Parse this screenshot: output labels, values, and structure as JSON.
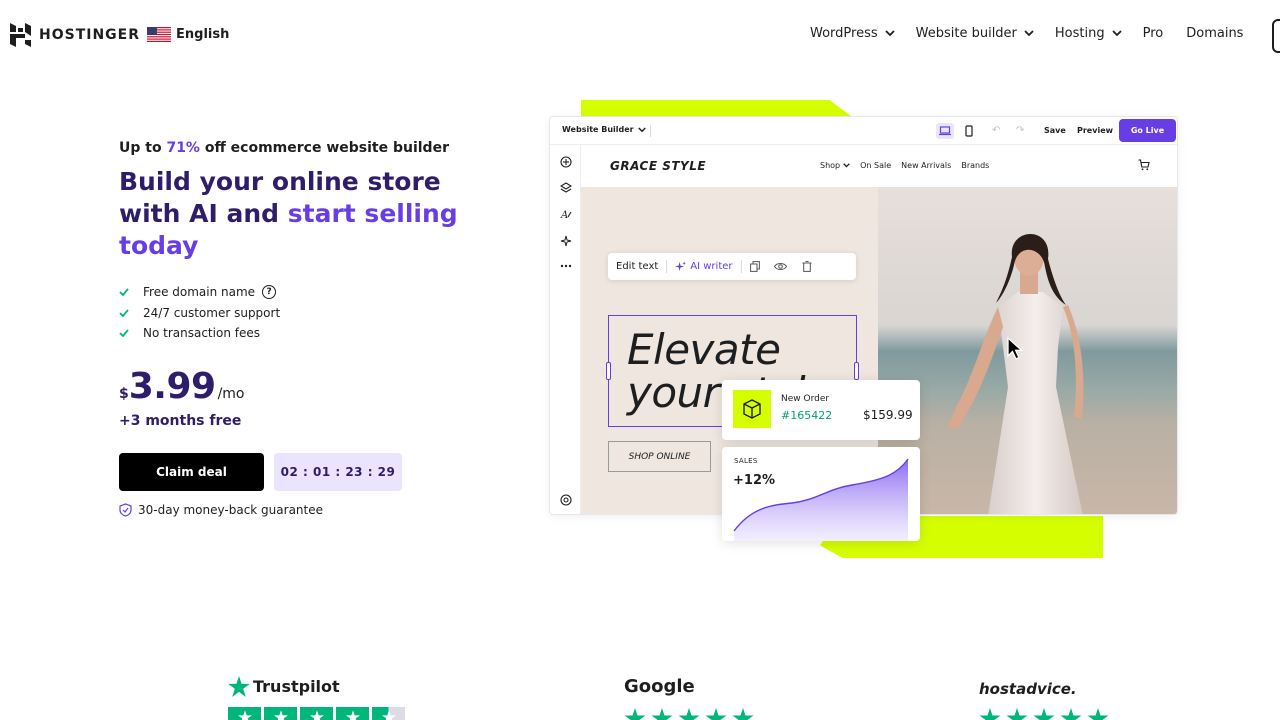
{
  "header": {
    "logo_text": "HOSTINGER",
    "language": "English",
    "nav": [
      {
        "label": "WordPress",
        "dropdown": true
      },
      {
        "label": "Website builder",
        "dropdown": true
      },
      {
        "label": "Hosting",
        "dropdown": true
      },
      {
        "label": "Pro",
        "dropdown": false
      },
      {
        "label": "Domains",
        "dropdown": false
      }
    ]
  },
  "hero": {
    "eyebrow_prefix": "Up to ",
    "eyebrow_discount": "71%",
    "eyebrow_suffix": " off ecommerce website builder",
    "headline_line1": "Build your online store",
    "headline_line2_plain": "with AI and ",
    "headline_line2_accent": "start selling",
    "headline_line3_accent": "today",
    "features": [
      "Free domain name",
      "24/7 customer support",
      "No transaction fees"
    ],
    "price_currency": "$",
    "price_value": "3.99",
    "price_period": "/mo",
    "bonus": "+3 months free",
    "cta_label": "Claim deal",
    "timer": "02 : 01 : 23 : 29",
    "guarantee": "30-day money-back guarantee"
  },
  "builder": {
    "title": "Website Builder",
    "save": "Save",
    "preview": "Preview",
    "go_live": "Go Live",
    "site": {
      "brand": "GRACE STYLE",
      "links": [
        "Shop",
        "On Sale",
        "New Arrivals",
        "Brands"
      ],
      "edit_text": "Edit text",
      "ai_writer": "AI writer",
      "headline_line1": "Elevate",
      "headline_line2": "your style",
      "shop_button": "SHOP ONLINE"
    },
    "order": {
      "label": "New Order",
      "id": "#165422",
      "price": "$159.99"
    },
    "sales": {
      "label": "SALES",
      "value": "+12%"
    }
  },
  "reviews": {
    "trustpilot": "Trustpilot",
    "google": "Google",
    "hostadvice": "hostadvice."
  },
  "colors": {
    "accent": "#673de6",
    "dark_purple": "#2f1c6a",
    "lime": "#d5ff00",
    "trustpilot_green": "#00b67a",
    "success_green": "#00a36c"
  }
}
